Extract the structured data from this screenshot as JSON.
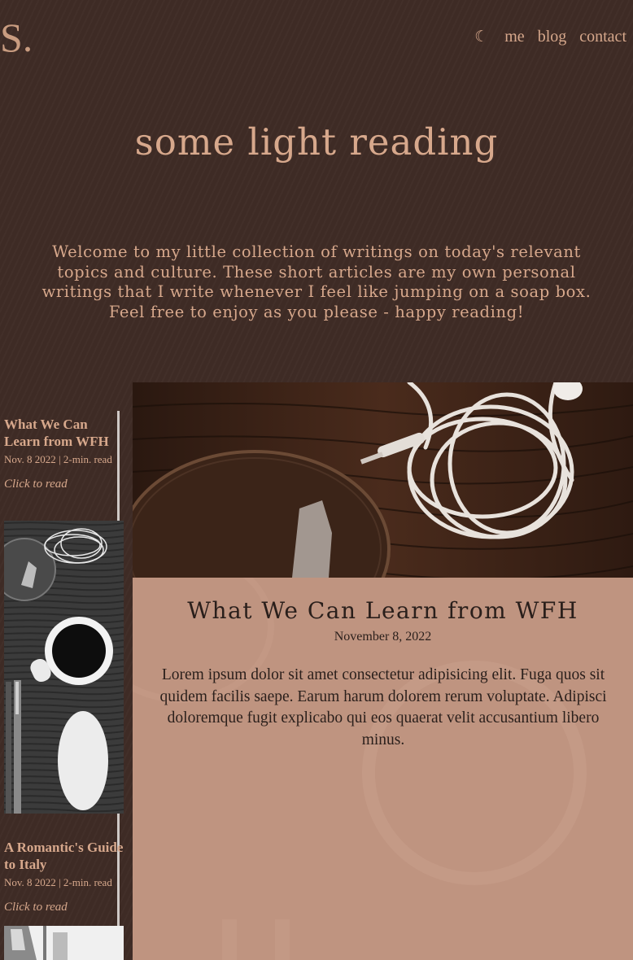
{
  "header": {
    "logo": "S.",
    "theme_toggle_icon": "moon-icon",
    "nav": {
      "me": "me",
      "blog": "blog",
      "contact": "contact"
    }
  },
  "hero": {
    "title": "some light reading",
    "intro": "Welcome to my little collection of writings on today's relevant topics and culture. These short articles are my own personal writings that I write whenever I feel like jumping on a soap box. Feel free to enjoy as you please - happy reading!"
  },
  "sidebar": {
    "posts": [
      {
        "title": "What We Can Learn from WFH",
        "meta": "Nov. 8 2022 | 2-min. read",
        "link": "Click to read"
      },
      {
        "title": "A Romantic's Guide to Italy",
        "meta": "Nov. 8 2022 | 2-min. read",
        "link": "Click to read"
      }
    ]
  },
  "feature": {
    "title": "What We Can Learn from WFH",
    "date": "November 8, 2022",
    "body": "Lorem ipsum dolor sit amet consectetur adipisicing elit. Fuga quos sit quidem facilis saepe. Earum harum dolorem rerum voluptate. Adipisci doloremque fugit explicabo qui eos quaerat velit accusantium libero minus."
  },
  "colors": {
    "background": "#3e2b25",
    "accent_text": "#d7a88c",
    "card": "#bf9480",
    "card_text": "#2a1f1b"
  }
}
